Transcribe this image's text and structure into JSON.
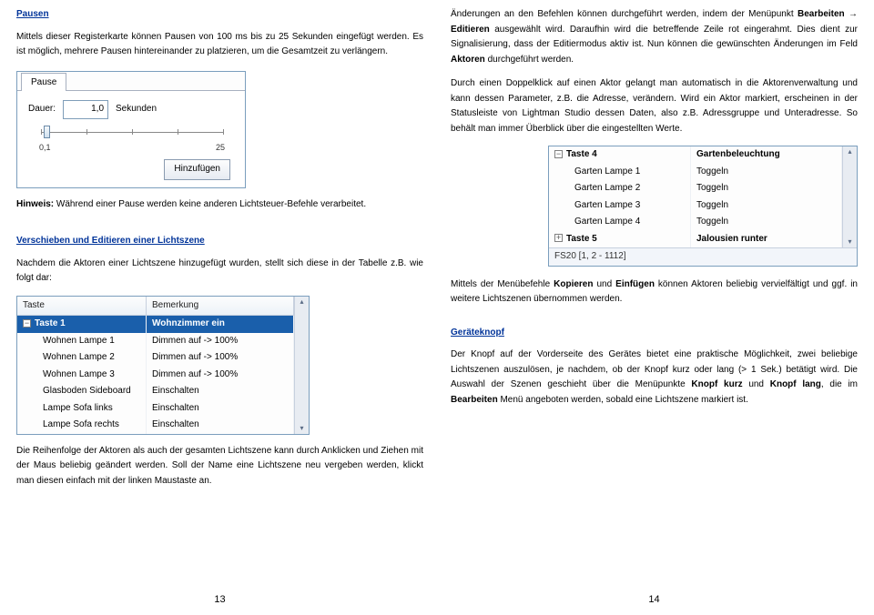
{
  "left": {
    "h_pausen": "Pausen",
    "p1": "Mittels dieser Registerkarte können Pausen von 100 ms bis zu 25 Sekunden eingefügt werden. Es ist möglich, mehrere Pausen hintereinander zu platzieren, um die Gesamtzeit zu verlängern.",
    "pause_ui": {
      "tab": "Pause",
      "dauer_label": "Dauer:",
      "dauer_value": "1,0",
      "dauer_unit": "Sekunden",
      "min": "0,1",
      "max": "25",
      "add_btn": "Hinzufügen"
    },
    "hinweis_label": "Hinweis:",
    "hinweis_text": "Während einer Pause werden keine anderen Lichtsteuer-Befehle verarbeitet.",
    "h_verschieben": "Verschieben und Editieren einer Lichtszene",
    "p2": "Nachdem die Aktoren einer Lichtszene hinzugefügt wurden, stellt sich diese in der Tabelle z.B. wie folgt dar:",
    "table1": {
      "headers": [
        "Taste",
        "Bemerkung"
      ],
      "row_hl": [
        "Taste 1",
        "Wohnzimmer ein"
      ],
      "rows": [
        [
          "Wohnen Lampe 1",
          "Dimmen auf -> 100%"
        ],
        [
          "Wohnen Lampe 2",
          "Dimmen auf -> 100%"
        ],
        [
          "Wohnen Lampe 3",
          "Dimmen auf -> 100%"
        ],
        [
          "Glasboden Sideboard",
          "Einschalten"
        ],
        [
          "Lampe Sofa links",
          "Einschalten"
        ],
        [
          "Lampe Sofa rechts",
          "Einschalten"
        ]
      ]
    },
    "p3": "Die Reihenfolge der Aktoren als auch der gesamten Lichtszene kann durch Anklicken und Ziehen mit der Maus beliebig geändert werden. Soll der Name eine Lichtszene neu vergeben werden, klickt man diesen einfach mit der linken Maustaste an.",
    "page_num": "13"
  },
  "right": {
    "p1a": "Änderungen an den Befehlen können durchgeführt werden, indem der Menüpunkt ",
    "p1b": "Bearbeiten",
    "p1c": "Editieren",
    "p1d": " ausgewählt wird. Daraufhin wird die betreffende Zeile rot eingerahmt. Dies dient zur Signalisierung, dass der Editiermodus aktiv ist. Nun können die gewünschten Änderungen im Feld ",
    "p1e": "Aktoren",
    "p1f": " durchgeführt werden.",
    "p2": "Durch einen Doppelklick auf einen Aktor gelangt man automatisch in die Aktorenverwaltung und kann dessen Parameter, z.B. die Adresse, verändern. Wird ein Aktor markiert, erscheinen in der Statusleiste von Lightman Studio dessen Daten, also z.B. Adressgruppe und Unteradresse. So behält man immer Überblick über die eingestellten Werte.",
    "table2": {
      "row_t4": [
        "Taste 4",
        "Gartenbeleuchtung"
      ],
      "rows": [
        [
          "Garten Lampe 1",
          "Toggeln"
        ],
        [
          "Garten Lampe 2",
          "Toggeln"
        ],
        [
          "Garten Lampe 3",
          "Toggeln"
        ],
        [
          "Garten Lampe 4",
          "Toggeln"
        ]
      ],
      "row_t5": [
        "Taste 5",
        "Jalousien runter"
      ],
      "status": "FS20 [1, 2 - 1112]"
    },
    "p3a": "Mittels der Menübefehle ",
    "p3b": "Kopieren",
    "p3c": " und ",
    "p3d": "Einfügen",
    "p3e": " können Aktoren beliebig vervielfältigt und ggf. in weitere Lichtszenen übernommen werden.",
    "h_knopf": "Geräteknopf",
    "p4a": "Der Knopf auf der Vorderseite des Gerätes bietet eine praktische Möglichkeit, zwei beliebige Lichtszenen auszulösen, je nachdem, ob der Knopf kurz oder lang (> 1 Sek.) betätigt wird. Die Auswahl der Szenen geschieht über die Menüpunkte ",
    "p4b": "Knopf kurz",
    "p4c": " und ",
    "p4d": "Knopf lang",
    "p4e": ", die im ",
    "p4f": "Bearbeiten",
    "p4g": " Menü angeboten werden, sobald eine Lichtszene markiert ist.",
    "page_num": "14"
  }
}
